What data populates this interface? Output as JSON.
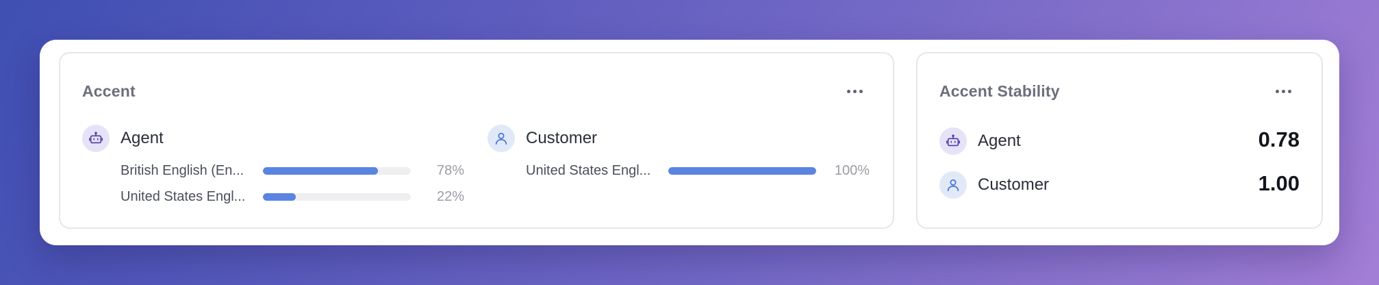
{
  "accent": {
    "title": "Accent",
    "columns": [
      {
        "speaker": "Agent",
        "icon": "robot-icon",
        "rows": [
          {
            "label": "British English (En...",
            "percent_text": "78%",
            "value": 0.78
          },
          {
            "label": "United States Engl...",
            "percent_text": "22%",
            "value": 0.22
          }
        ]
      },
      {
        "speaker": "Customer",
        "icon": "user-icon",
        "rows": [
          {
            "label": "United States Engl...",
            "percent_text": "100%",
            "value": 1.0
          }
        ]
      }
    ]
  },
  "stability": {
    "title": "Accent Stability",
    "rows": [
      {
        "speaker": "Agent",
        "icon": "robot-icon",
        "value": "0.78"
      },
      {
        "speaker": "Customer",
        "icon": "user-icon",
        "value": "1.00"
      }
    ]
  },
  "colors": {
    "bar_fill": "#5b84e0",
    "bar_track": "#efeff1",
    "agent_avatar_bg": "#e6e2f7",
    "customer_avatar_bg": "#e1e9f8"
  }
}
